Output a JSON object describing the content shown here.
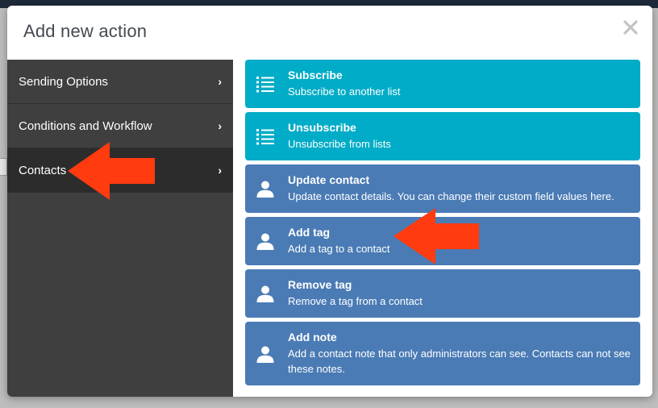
{
  "modal": {
    "title": "Add new action",
    "close_label": "×"
  },
  "sidebar": {
    "items": [
      {
        "label": "Sending Options",
        "chevron": "›",
        "active": false
      },
      {
        "label": "Conditions and Workflow",
        "chevron": "›",
        "active": false
      },
      {
        "label": "Contacts",
        "chevron": "›",
        "active": true
      }
    ]
  },
  "actions": [
    {
      "title": "Subscribe",
      "desc": "Subscribe to another list",
      "icon": "list-icon",
      "color": "#00acc7"
    },
    {
      "title": "Unsubscribe",
      "desc": "Unsubscribe from lists",
      "icon": "list-icon",
      "color": "#00acc7"
    },
    {
      "title": "Update contact",
      "desc": "Update contact details. You can change their custom field values here.",
      "icon": "user-icon",
      "color": "#4a7bb5"
    },
    {
      "title": "Add tag",
      "desc": "Add a tag to a contact",
      "icon": "user-icon",
      "color": "#4a7bb5"
    },
    {
      "title": "Remove tag",
      "desc": "Remove a tag from a contact",
      "icon": "user-icon",
      "color": "#4a7bb5"
    },
    {
      "title": "Add note",
      "desc": "Add a contact note that only administrators can see. Contacts can not see these notes.",
      "icon": "user-icon",
      "color": "#4a7bb5"
    }
  ],
  "colors": {
    "annotation_arrow": "#ff3b0f",
    "sidebar_bg": "#3f3f3f",
    "sidebar_active": "#2c2c2c"
  }
}
